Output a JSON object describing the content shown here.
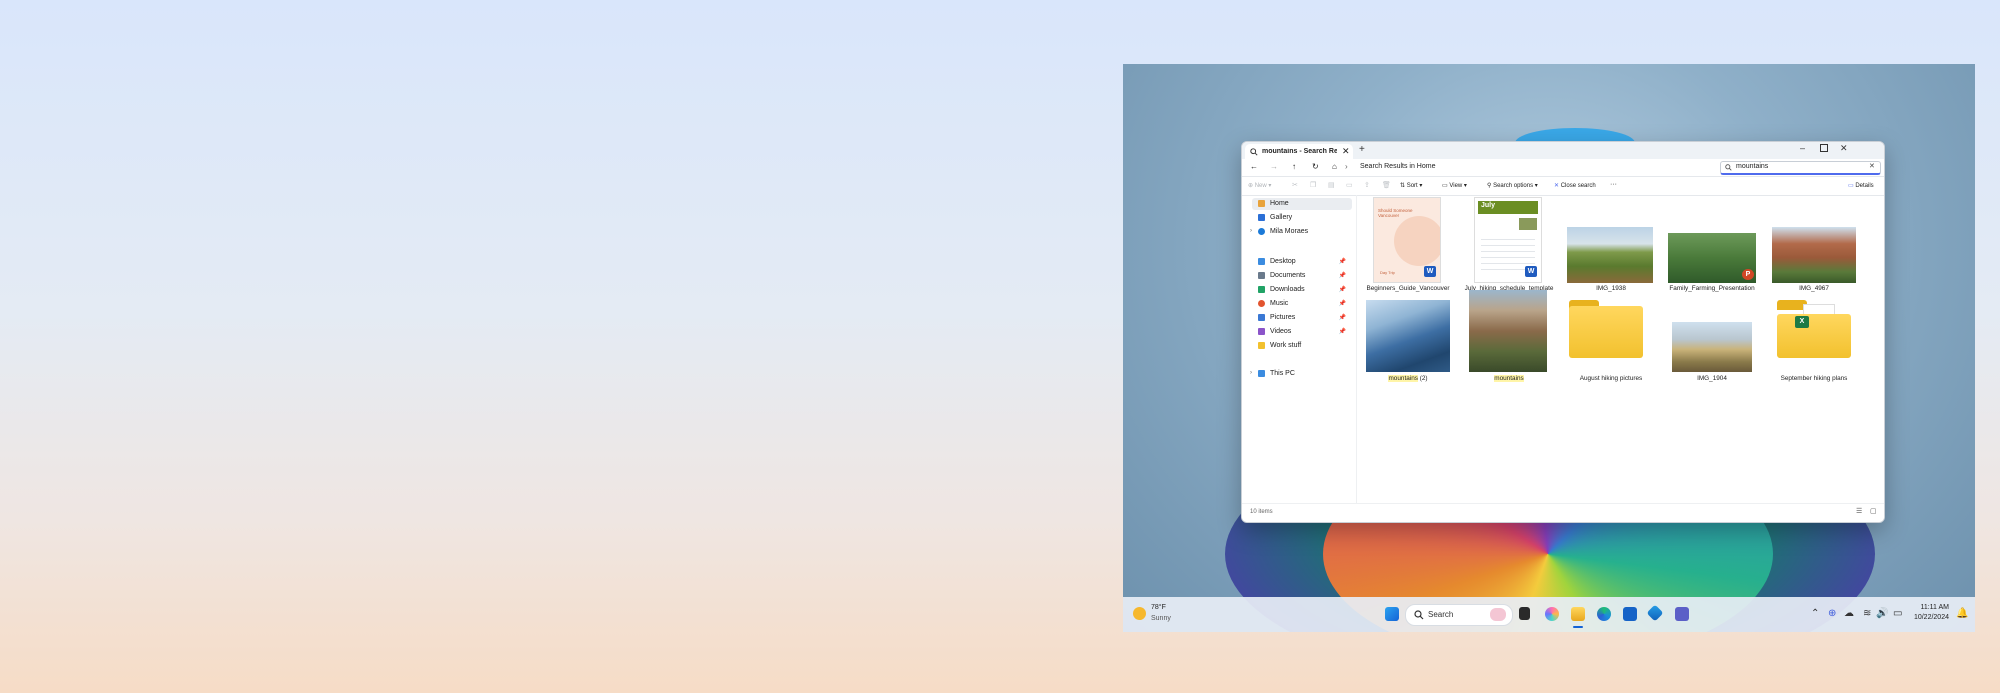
{
  "window": {
    "tab_title": "mountains - Search Results i",
    "breadcrumb": "Search Results in Home",
    "search_value": "mountains"
  },
  "toolbar": {
    "new_label": "New",
    "sort_label": "Sort",
    "view_label": "View",
    "search_options_label": "Search options",
    "close_search_label": "Close search",
    "more_label": "···",
    "details_label": "Details"
  },
  "sidebar": {
    "items": [
      {
        "label": "Home",
        "icon": "home-icon",
        "color": "#e8a33c"
      },
      {
        "label": "Gallery",
        "icon": "gallery-icon",
        "color": "#2b6fd6"
      },
      {
        "label": "Mila Moraes",
        "icon": "onedrive-icon",
        "color": "#1b7ad8"
      },
      {
        "label": "Desktop",
        "icon": "desktop-icon",
        "color": "#3b8ce0"
      },
      {
        "label": "Documents",
        "icon": "documents-icon",
        "color": "#6a7a8c"
      },
      {
        "label": "Downloads",
        "icon": "downloads-icon",
        "color": "#21a366"
      },
      {
        "label": "Music",
        "icon": "music-icon",
        "color": "#e2542f"
      },
      {
        "label": "Pictures",
        "icon": "pictures-icon",
        "color": "#3a78d4"
      },
      {
        "label": "Videos",
        "icon": "videos-icon",
        "color": "#8b54c9"
      },
      {
        "label": "Work stuff",
        "icon": "folder-icon",
        "color": "#f2c12e"
      },
      {
        "label": "This PC",
        "icon": "this-pc-icon",
        "color": "#3b8ce0"
      }
    ]
  },
  "files": [
    {
      "name": "Beginners_Guide_Vancouver",
      "type": "word-doc",
      "doc_title": "Should Someone Vancouver",
      "doc_foot": "Day Trip"
    },
    {
      "name": "July_hiking_schedule_template",
      "type": "word-doc",
      "doc_title": "July"
    },
    {
      "name": "IMG_1938",
      "type": "image"
    },
    {
      "name": "Family_Farming_Presentation",
      "type": "powerpoint"
    },
    {
      "name": "IMG_4967",
      "type": "image"
    },
    {
      "name_hl": "mountains",
      "name_rest": " (2)",
      "type": "image"
    },
    {
      "name_hl": "mountains",
      "name_rest": "",
      "type": "image"
    },
    {
      "name": "August hiking pictures",
      "type": "folder"
    },
    {
      "name": "IMG_1904",
      "type": "image"
    },
    {
      "name": "September hiking plans",
      "type": "folder-excel"
    }
  ],
  "status": {
    "count": "10 items"
  },
  "taskbar": {
    "weather_temp": "78°F",
    "weather_desc": "Sunny",
    "search_label": "Search",
    "time": "11:11 AM",
    "date": "10/22/2024"
  }
}
